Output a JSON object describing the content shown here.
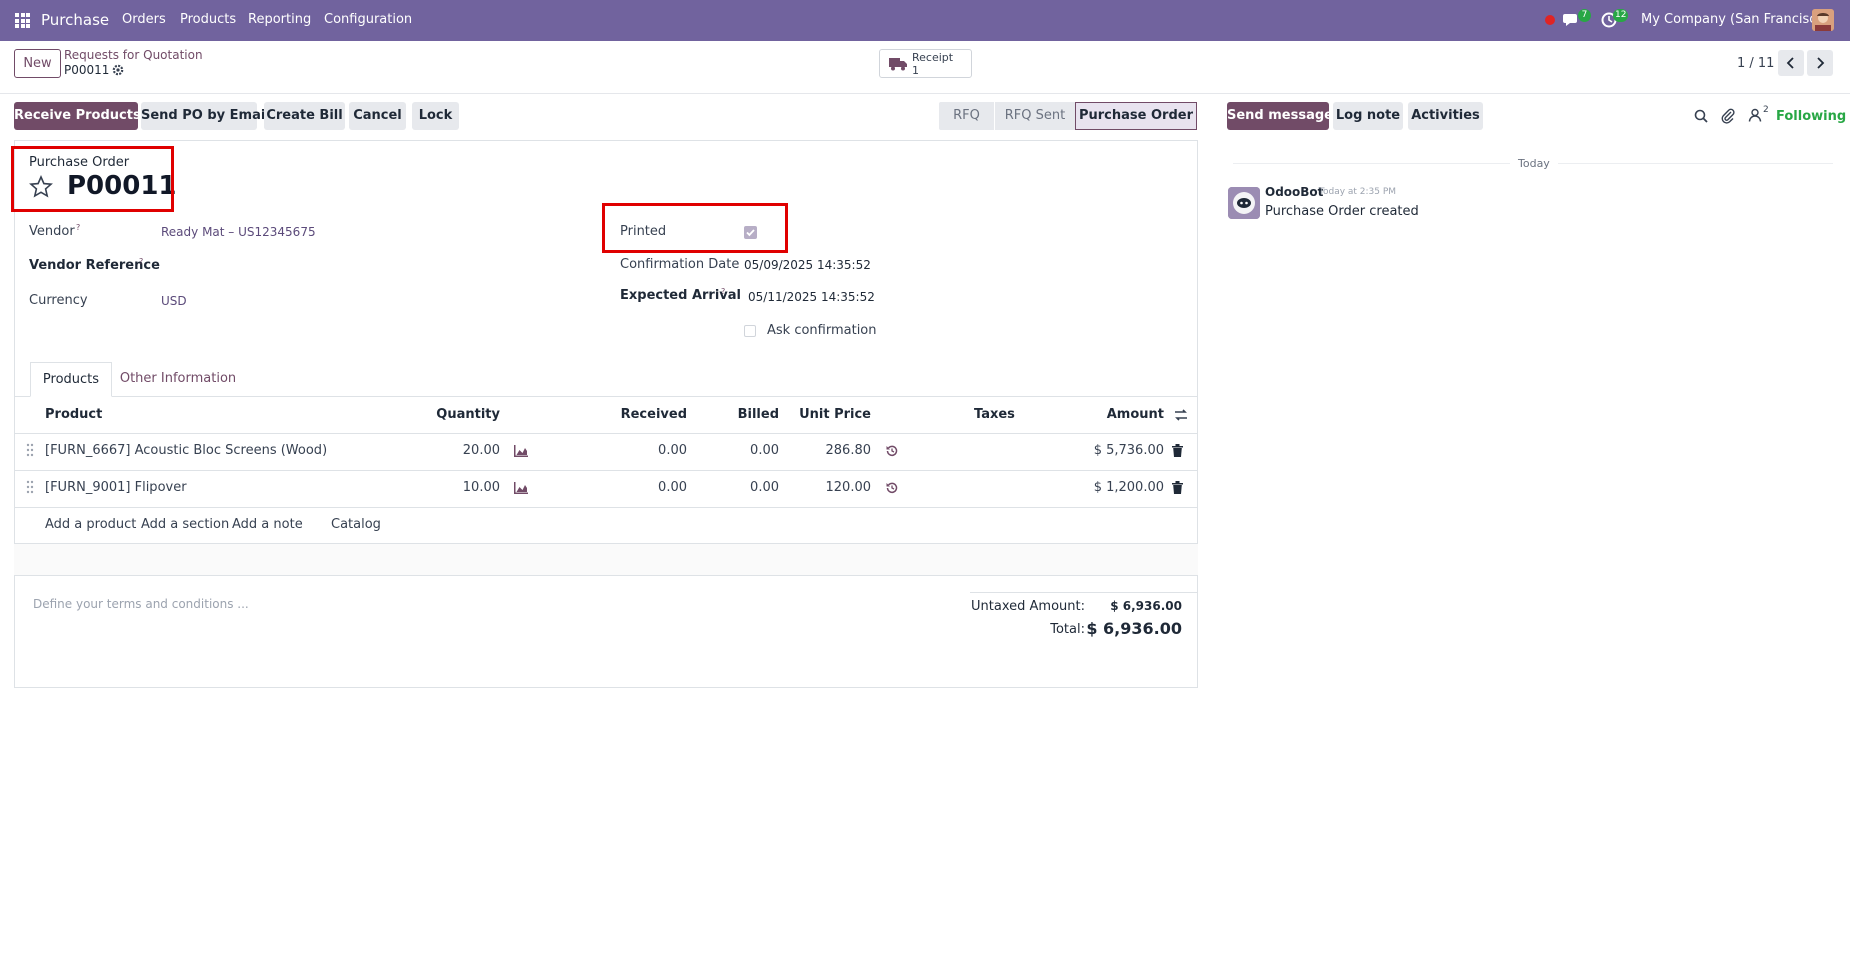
{
  "nav": {
    "app_name": "Purchase",
    "menu": [
      "Orders",
      "Products",
      "Reporting",
      "Configuration"
    ],
    "chat_count": "7",
    "activity_count": "12",
    "company": "My Company (San Francisco)"
  },
  "control": {
    "new_label": "New",
    "breadcrumb_parent": "Requests for Quotation",
    "breadcrumb_current": "P00011",
    "receipt_label": "Receipt",
    "receipt_count": "1",
    "pager": "1 / 11"
  },
  "actions": {
    "receive_products": "Receive Products",
    "send_po_email": "Send PO by Email",
    "create_bill": "Create Bill",
    "cancel": "Cancel",
    "lock": "Lock"
  },
  "status": [
    "RFQ",
    "RFQ Sent",
    "Purchase Order"
  ],
  "form": {
    "doc_type": "Purchase Order",
    "doc_number": "P00011",
    "vendor_label": "Vendor",
    "vendor_value": "Ready Mat – US12345675",
    "vendor_ref_label": "Vendor Reference",
    "currency_label": "Currency",
    "currency_value": "USD",
    "printed_label": "Printed",
    "confirmation_label": "Confirmation Date",
    "confirmation_value": "05/09/2025 14:35:52",
    "expected_label": "Expected Arrival",
    "expected_value": "05/11/2025 14:35:52",
    "ask_confirmation_label": "Ask confirmation",
    "help_mark": "?"
  },
  "tabs": [
    "Products",
    "Other Information"
  ],
  "table": {
    "headers": [
      "Product",
      "Quantity",
      "Received",
      "Billed",
      "Unit Price",
      "Taxes",
      "Amount"
    ],
    "rows": [
      {
        "product": "[FURN_6667] Acoustic Bloc Screens (Wood)",
        "quantity": "20.00",
        "received": "0.00",
        "billed": "0.00",
        "unit_price": "286.80",
        "amount": "$ 5,736.00"
      },
      {
        "product": "[FURN_9001] Flipover",
        "quantity": "10.00",
        "received": "0.00",
        "billed": "0.00",
        "unit_price": "120.00",
        "amount": "$ 1,200.00"
      }
    ],
    "add_product": "Add a product",
    "add_section": "Add a section",
    "add_note": "Add a note",
    "catalog": "Catalog"
  },
  "footer": {
    "terms_placeholder": "Define your terms and conditions ...",
    "untaxed_label": "Untaxed Amount:",
    "untaxed_value": "$ 6,936.00",
    "total_label": "Total:",
    "total_value": "$ 6,936.00"
  },
  "chatter": {
    "send_message": "Send message",
    "log_note": "Log note",
    "activities": "Activities",
    "followers_count": "2",
    "following": "Following",
    "date_separator": "Today",
    "author": "OdooBot",
    "time": "Today at 2:35 PM",
    "message": "Purchase Order created"
  },
  "colors": {
    "navbar": "#71639e",
    "primary": "#714b67",
    "highlight": "#e00000",
    "following": "#28a745"
  }
}
